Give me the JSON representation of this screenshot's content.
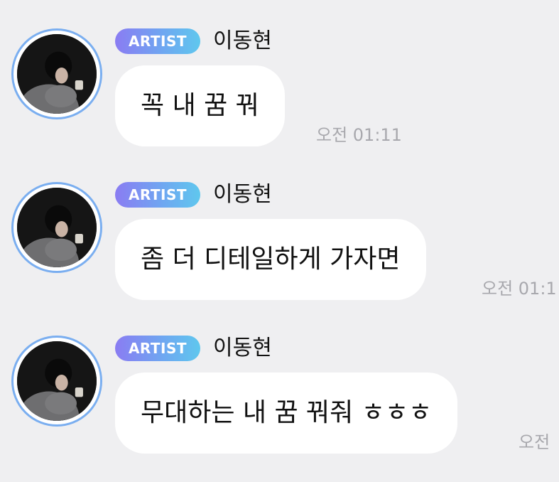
{
  "messages": [
    {
      "badge": "ARTIST",
      "sender": "이동현",
      "text": "꼭 내 꿈 꿔",
      "time": "오전 01:11"
    },
    {
      "badge": "ARTIST",
      "sender": "이동현",
      "text": "좀 더 디테일하게 가자면",
      "time": "오전 01:1"
    },
    {
      "badge": "ARTIST",
      "sender": "이동현",
      "text": "무대하는 내 꿈 꿔줘 ㅎㅎㅎ",
      "time": "오전"
    }
  ],
  "colors": {
    "background": "#efeff1",
    "bubble": "#ffffff",
    "avatar_ring": "#7aaef0",
    "badge_gradient_start": "#8a7cf2",
    "badge_gradient_end": "#5fc7ee",
    "timestamp": "#a8a8ad"
  },
  "icons": {
    "avatar": "profile-photo"
  }
}
